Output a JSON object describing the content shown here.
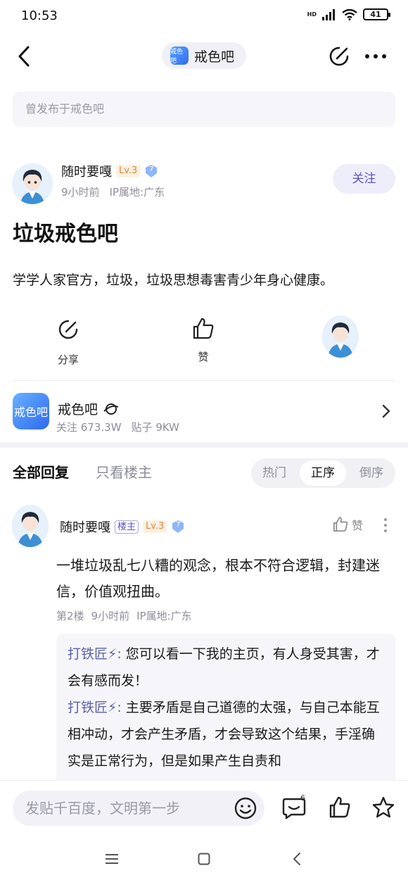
{
  "status_bar": {
    "time": "10:53",
    "network": "HD",
    "battery": "41"
  },
  "nav": {
    "forum_logo_text": "戒色吧",
    "forum_name": "戒色吧"
  },
  "origin": {
    "text": "曾发布于戒色吧"
  },
  "post": {
    "author": "随时要嘎",
    "level": "Lv.3",
    "verified_badge": "7",
    "time": "9小时前",
    "ip": "IP属地:广东",
    "follow_label": "关注",
    "title": "垃圾戒色吧",
    "body": "学学人家官方，垃圾，垃圾思想毒害青少年身心健康。"
  },
  "actions": {
    "share_label": "分享",
    "like_label": "赞"
  },
  "forum_card": {
    "logo_text": "戒色吧",
    "name": "戒色吧",
    "followers": "关注 673.3W",
    "posts": "贴子 9KW"
  },
  "reply_tabs": {
    "all": "全部回复",
    "host_only": "只看楼主",
    "sort": [
      "热门",
      "正序",
      "倒序"
    ],
    "sort_active": "正序"
  },
  "reply": {
    "author": "随时要嘎",
    "host_badge": "楼主",
    "level": "Lv.3",
    "verified_badge": "7",
    "like_label": "赞",
    "text": "一堆垃圾乱七八糟的观念，根本不符合逻辑，封建迷信，价值观扭曲。",
    "floor": "第2楼",
    "time": "9小时前",
    "ip": "IP属地:广东",
    "sub_replies": [
      {
        "user": "打铁匠⚡:",
        "text": " 您可以看一下我的主页，有人身受其害，才会有感而发！"
      },
      {
        "user": "打铁匠⚡:",
        "text": " 主要矛盾是自己道德的太强，与自己本能互相冲动，才会产生矛盾，才会导致这个结果，手淫确实是正常行为，但是如果产生自责和"
      }
    ]
  },
  "bottom_bar": {
    "input_placeholder": "发贴千百度，文明第一步",
    "comment_count": "6"
  },
  "colors": {
    "accent": "#5a55c8",
    "level": "#d9893a",
    "verified": "#5b8ef0"
  }
}
